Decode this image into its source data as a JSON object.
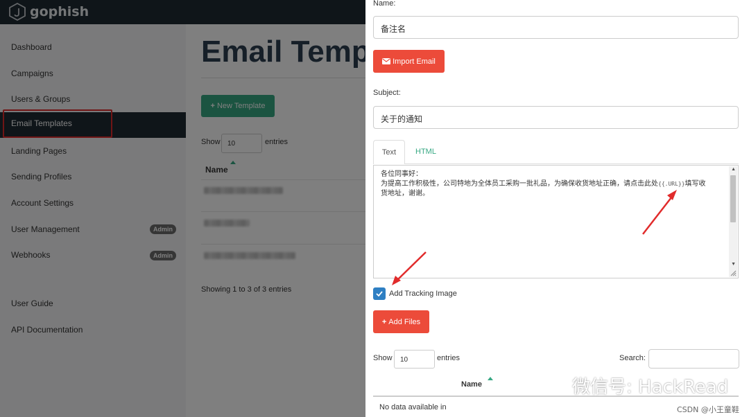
{
  "app": {
    "brand": "gophish"
  },
  "sidebar": {
    "items": [
      {
        "label": "Dashboard"
      },
      {
        "label": "Campaigns"
      },
      {
        "label": "Users & Groups"
      },
      {
        "label": "Email Templates",
        "active": true
      },
      {
        "label": "Landing Pages"
      },
      {
        "label": "Sending Profiles"
      },
      {
        "label": "Account Settings"
      },
      {
        "label": "User Management",
        "badge": "Admin"
      },
      {
        "label": "Webhooks",
        "badge": "Admin"
      },
      {
        "label": "User Guide"
      },
      {
        "label": "API Documentation"
      }
    ]
  },
  "main": {
    "title": "Email Templ",
    "new_template_label": "New Template",
    "show_label": "Show",
    "entries_label": "entries",
    "page_length": "10",
    "column_name": "Name",
    "showing_text": "Showing 1 to 3 of 3 entries"
  },
  "modal": {
    "name_label": "Name:",
    "name_value": "备注名",
    "import_email_label": "Import Email",
    "subject_label": "Subject:",
    "subject_value": "关于的通知",
    "tabs": [
      {
        "label": "Text",
        "active": true
      },
      {
        "label": "HTML"
      }
    ],
    "body_line1": "各位同事好：",
    "body_line2a": "为提高工作积极性，公司特地为全体员工采购一批礼品，为确保收货地址正确，请点击此处",
    "body_code": "{{.URL}}",
    "body_line2b": "填写收",
    "body_line3": "货地址，谢谢。",
    "tracking_label": "Add Tracking Image",
    "tracking_checked": true,
    "add_files_label": "Add Files",
    "show_label": "Show",
    "entries_label": "entries",
    "page_length": "10",
    "search_label": "Search:",
    "column_name": "Name",
    "no_data_text": "No data available in"
  },
  "watermark": {
    "wechat": "微信号: HackRead",
    "csdn": "CSDN @小王童鞋"
  },
  "colors": {
    "topbar": "#1f2a33",
    "green": "#37a883",
    "red": "#ec4b3a",
    "highlight": "#e12b2b"
  }
}
